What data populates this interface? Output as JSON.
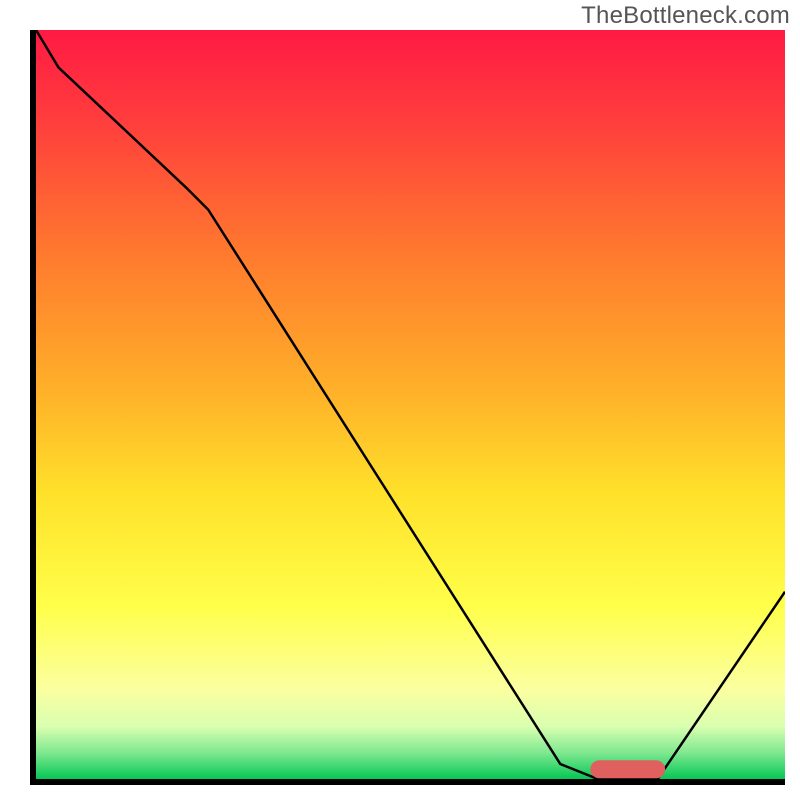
{
  "watermark": "TheBottleneck.com",
  "chart_data": {
    "type": "line",
    "title": "",
    "xlabel": "",
    "ylabel": "",
    "xlim": [
      0,
      100
    ],
    "ylim": [
      0,
      100
    ],
    "grid": false,
    "legend": false,
    "background_gradient": [
      {
        "pos": 0.0,
        "color": "#ff1a44"
      },
      {
        "pos": 0.12,
        "color": "#ff3d3d"
      },
      {
        "pos": 0.3,
        "color": "#ff7a2e"
      },
      {
        "pos": 0.48,
        "color": "#ffb029"
      },
      {
        "pos": 0.62,
        "color": "#ffe12a"
      },
      {
        "pos": 0.77,
        "color": "#ffff4a"
      },
      {
        "pos": 0.88,
        "color": "#fbffa0"
      },
      {
        "pos": 0.93,
        "color": "#d9ffb0"
      },
      {
        "pos": 0.965,
        "color": "#7fe890"
      },
      {
        "pos": 1.0,
        "color": "#06c755"
      }
    ],
    "series": [
      {
        "name": "bottleneck-curve",
        "color": "#000000",
        "stroke_width": 2.5,
        "x": [
          0,
          3,
          20,
          23,
          70,
          75,
          83,
          100
        ],
        "y": [
          100,
          95,
          79,
          76,
          2,
          0,
          0,
          25
        ]
      }
    ],
    "marker": {
      "name": "optimal-range",
      "shape": "rounded-bar",
      "color": "#e06060",
      "x_start": 74,
      "x_end": 84,
      "y": 1.3,
      "height": 2.4
    }
  }
}
